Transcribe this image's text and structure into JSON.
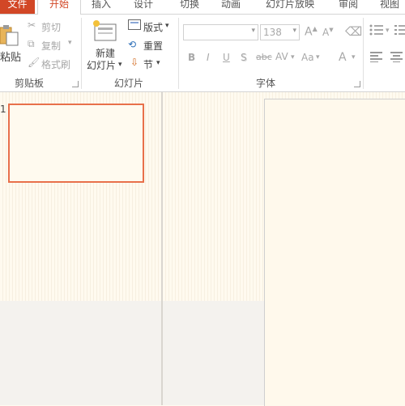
{
  "tabs": [
    {
      "id": "file",
      "label": "文件"
    },
    {
      "id": "home",
      "label": "开始"
    },
    {
      "id": "insert",
      "label": "插入"
    },
    {
      "id": "design",
      "label": "设计"
    },
    {
      "id": "transitions",
      "label": "切换"
    },
    {
      "id": "animations",
      "label": "动画"
    },
    {
      "id": "slideshow",
      "label": "幻灯片放映"
    },
    {
      "id": "review",
      "label": "审阅"
    },
    {
      "id": "view",
      "label": "视图"
    }
  ],
  "clipboard": {
    "group_label": "剪贴板",
    "paste_label": "粘贴",
    "cut_label": "剪切",
    "copy_label": "复制",
    "format_painter_label": "格式刷"
  },
  "slides_group": {
    "group_label": "幻灯片",
    "new_slide_line1": "新建",
    "new_slide_line2": "幻灯片",
    "layout_label": "版式",
    "reset_label": "重置",
    "section_label": "节"
  },
  "font_group": {
    "group_label": "字体",
    "font_name_value": "",
    "font_size_value": "138",
    "grow_label": "A",
    "shrink_label": "A",
    "bold_label": "B",
    "italic_label": "I",
    "underline_label": "U",
    "shadow_label": "S",
    "strike_label": "abc",
    "spacing_label": "AV",
    "case_label": "Aa",
    "color_label": "A"
  },
  "thumbnail": {
    "number": "1"
  }
}
